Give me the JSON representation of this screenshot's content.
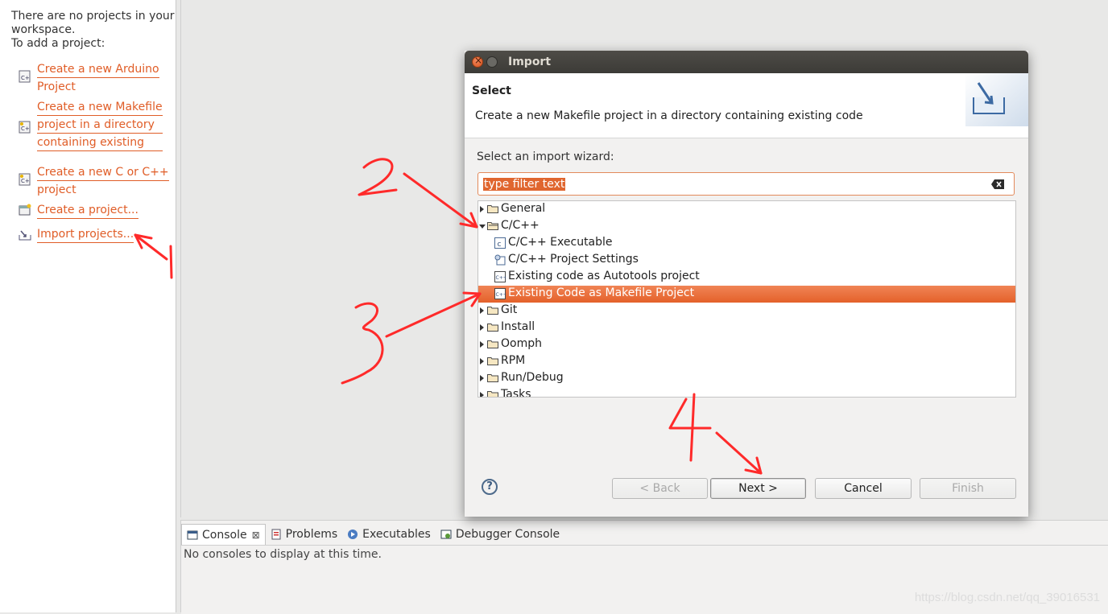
{
  "left_panel": {
    "message_lines": [
      "There are no projects in your",
      "workspace.",
      "To add a project:"
    ],
    "links": [
      {
        "lines": [
          "Create a new Arduino",
          "Project"
        ],
        "icon": "cpp-project-icon"
      },
      {
        "lines": [
          "Create a new Makefile",
          "project in a directory",
          "containing existing"
        ],
        "icon": "makefile-project-icon"
      },
      {
        "lines": [
          "Create a new C or C++",
          "project"
        ],
        "icon": "c-project-icon"
      },
      {
        "lines": [
          "Create a project..."
        ],
        "icon": "new-project-icon"
      },
      {
        "lines": [
          "Import projects..."
        ],
        "icon": "import-icon"
      }
    ]
  },
  "dialog": {
    "title": "Import",
    "header_title": "Select",
    "header_desc": "Create a new Makefile project in a directory containing existing code",
    "wizard_label": "Select an import wizard:",
    "filter_placeholder": "type filter text",
    "tree": [
      {
        "label": "General",
        "level": 0,
        "type": "folder",
        "expanded": false
      },
      {
        "label": "C/C++",
        "level": 0,
        "type": "folder",
        "expanded": true
      },
      {
        "label": "C/C++ Executable",
        "level": 1,
        "type": "c-file"
      },
      {
        "label": "C/C++ Project Settings",
        "level": 1,
        "type": "settings"
      },
      {
        "label": "Existing code as Autotools project",
        "level": 1,
        "type": "cpp-file"
      },
      {
        "label": "Existing Code as Makefile Project",
        "level": 1,
        "type": "cpp-file",
        "selected": true
      },
      {
        "label": "Git",
        "level": 0,
        "type": "folder",
        "expanded": false
      },
      {
        "label": "Install",
        "level": 0,
        "type": "folder",
        "expanded": false
      },
      {
        "label": "Oomph",
        "level": 0,
        "type": "folder",
        "expanded": false
      },
      {
        "label": "RPM",
        "level": 0,
        "type": "folder",
        "expanded": false
      },
      {
        "label": "Run/Debug",
        "level": 0,
        "type": "folder",
        "expanded": false
      },
      {
        "label": "Tasks",
        "level": 0,
        "type": "folder",
        "expanded": false
      }
    ],
    "buttons": {
      "back": "< Back",
      "next": "Next >",
      "cancel": "Cancel",
      "finish": "Finish"
    },
    "help": "?"
  },
  "console": {
    "tabs": [
      {
        "label": "Console",
        "active": true,
        "icon": "console-icon"
      },
      {
        "label": "Problems",
        "active": false,
        "icon": "problems-icon"
      },
      {
        "label": "Executables",
        "active": false,
        "icon": "executables-icon"
      },
      {
        "label": "Debugger Console",
        "active": false,
        "icon": "debugger-console-icon"
      }
    ],
    "close_glyph": "⊠",
    "message": "No consoles to display at this time."
  },
  "watermark": "https://blog.csdn.net/qq_39016531",
  "colors": {
    "accent": "#e4612a",
    "link": "#e05d27",
    "annotation": "#ff2a2a"
  }
}
